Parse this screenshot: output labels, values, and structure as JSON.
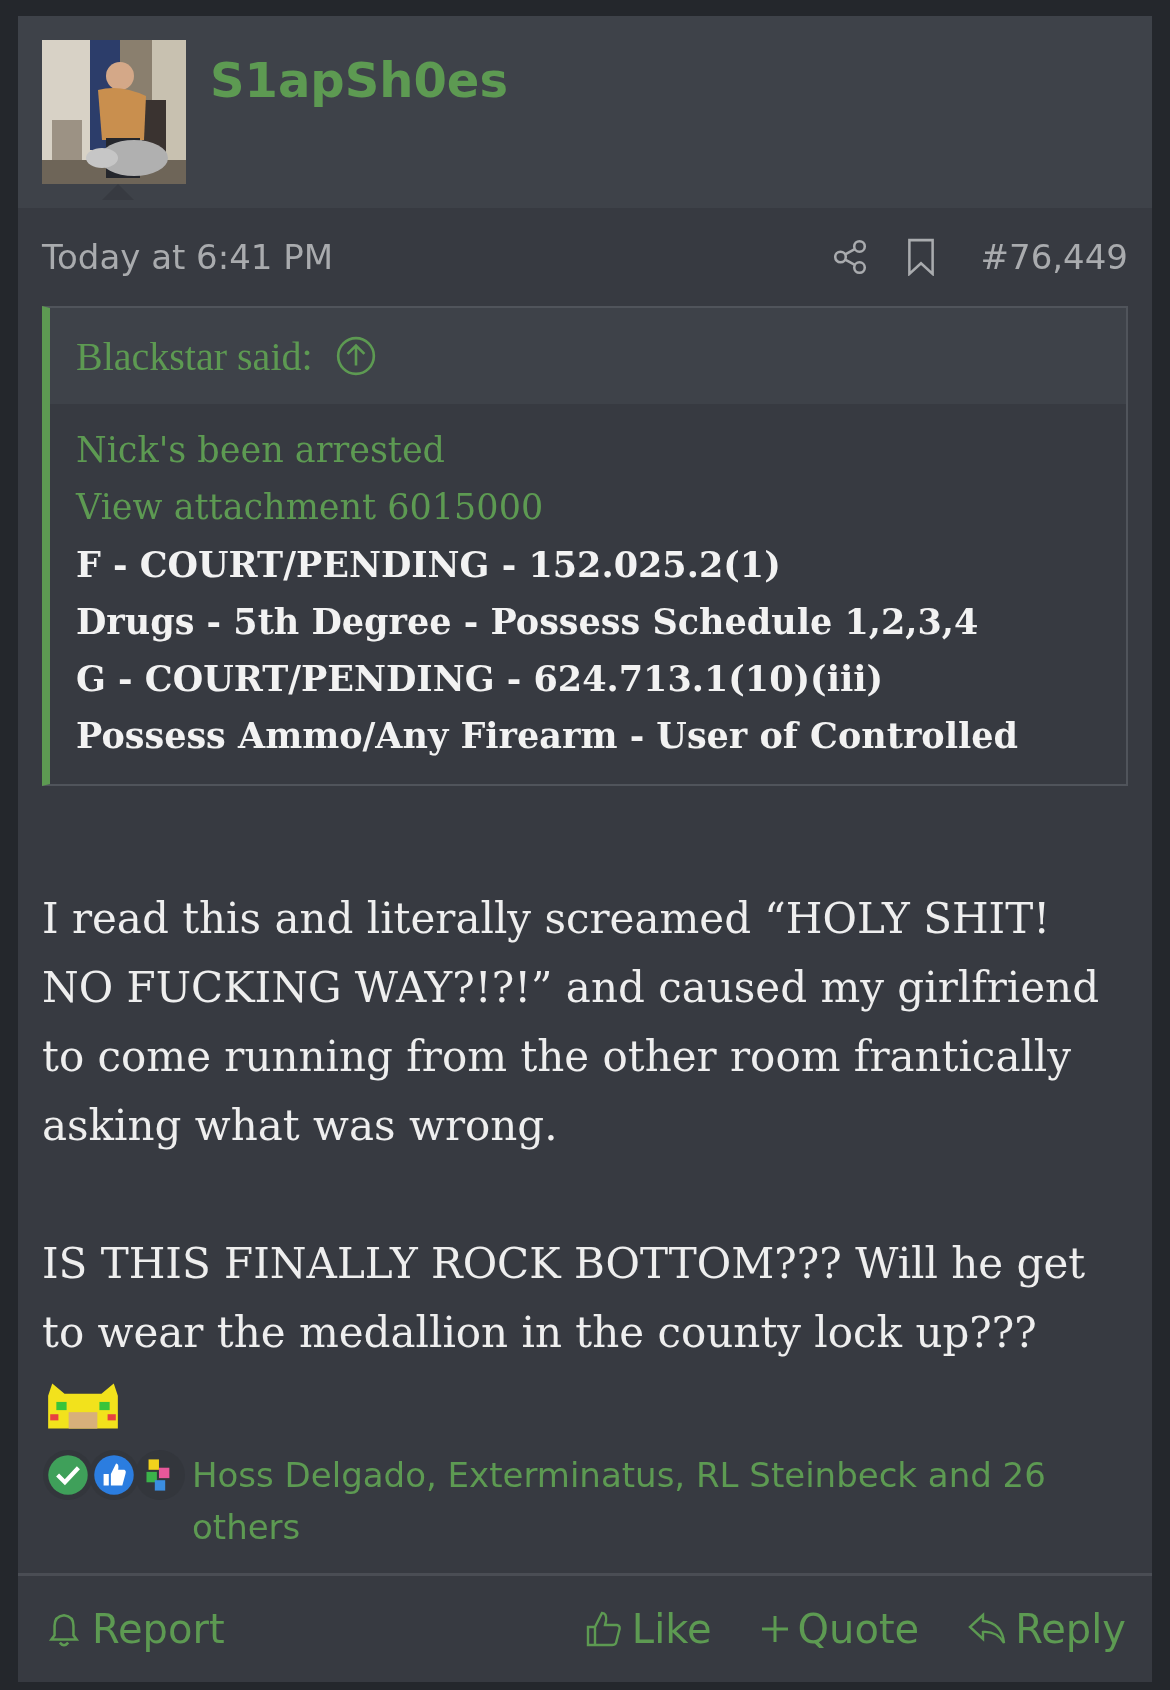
{
  "post": {
    "author": "S1apSh0es",
    "avatar": {
      "kind": "picture"
    },
    "time": "Today at 6:41 PM",
    "number": "#76,449",
    "quote": {
      "author_line": "Blackstar said:",
      "lines": [
        {
          "kind": "link",
          "text": "Nick's been arrested"
        },
        {
          "kind": "link",
          "text": "View attachment 6015000"
        },
        {
          "kind": "bold",
          "text": "F - COURT/PENDING - 152.025.2(1)"
        },
        {
          "kind": "bold",
          "text": "Drugs - 5th Degree - Possess Schedule 1,2,3,4"
        },
        {
          "kind": "bold",
          "text": "G - COURT/PENDING - 624.713.1(10)(iii)"
        },
        {
          "kind": "bold",
          "text": "Possess Ammo/Any Firearm - User of Controlled"
        }
      ]
    },
    "paragraphs": [
      "I read this and literally screamed “HOLY SHIT! NO FUCKING WAY?!?!” and caused my girlfriend to come running from the other room frantically asking what was wrong.",
      "IS THIS FINALLY ROCK BOTTOM??? Will he get to wear the medallion in the county lock up???"
    ],
    "smilie": {
      "kind": "pixel-face"
    },
    "reactions": {
      "icons": [
        {
          "kind": "check"
        },
        {
          "kind": "like"
        },
        {
          "kind": "puzzle"
        }
      ],
      "text": "Hoss Delgado, Exterminatus, RL Steinbeck and 26 others"
    },
    "actions": [
      {
        "kind": "bell",
        "label": "Report"
      },
      {
        "kind": "like",
        "label": "Like"
      },
      {
        "kind": "plus",
        "label": "Quote"
      },
      {
        "kind": "reply",
        "label": "Reply"
      }
    ]
  }
}
